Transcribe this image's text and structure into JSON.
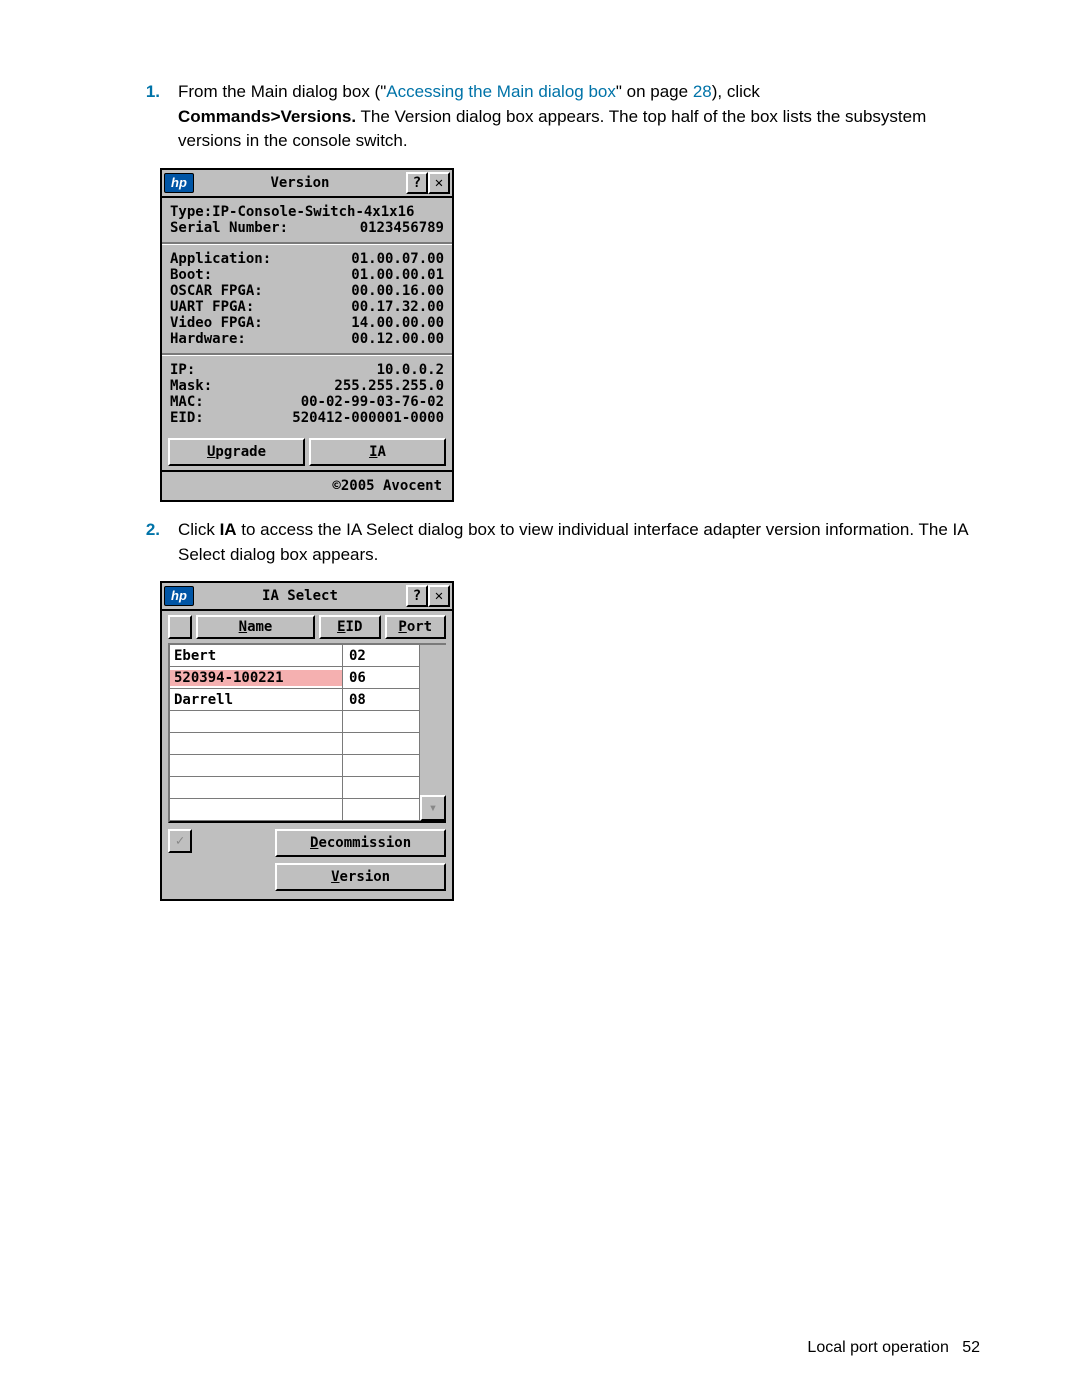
{
  "step1": {
    "num": "1.",
    "pre_text": "From the Main dialog box (\"",
    "link": "Accessing the Main dialog box",
    "post_link": "\" on page ",
    "page_ref": "28",
    "after_ref": "), click",
    "bold": "Commands>Versions.",
    "rest": " The Version dialog box appears. The top half of the box lists the subsystem versions in the console switch."
  },
  "version_dialog": {
    "title": "Version",
    "help": "?",
    "close": "✕",
    "logo": "hp",
    "type_label": "Type:",
    "type_value": "IP-Console-Switch-4x1x16",
    "serial_label": "Serial Number:",
    "serial_value": "0123456789",
    "rows": [
      {
        "k": "Application:",
        "v": "01.00.07.00"
      },
      {
        "k": "Boot:",
        "v": "01.00.00.01"
      },
      {
        "k": "OSCAR FPGA:",
        "v": "00.00.16.00"
      },
      {
        "k": "UART FPGA:",
        "v": "00.17.32.00"
      },
      {
        "k": "Video FPGA:",
        "v": "14.00.00.00"
      },
      {
        "k": "Hardware:",
        "v": "00.12.00.00"
      }
    ],
    "net": [
      {
        "k": "IP:",
        "v": "10.0.0.2"
      },
      {
        "k": "Mask:",
        "v": "255.255.255.0"
      },
      {
        "k": "MAC:",
        "v": "00-02-99-03-76-02"
      },
      {
        "k": "EID:",
        "v": "520412-000001-0000"
      }
    ],
    "upgrade_u": "U",
    "upgrade_rest": "pgrade",
    "ia_u": "I",
    "ia_rest": "A",
    "copyright": "©2005 Avocent"
  },
  "step2": {
    "num": "2.",
    "pre": "Click ",
    "bold": "IA",
    "rest": " to access the IA Select dialog box to view individual interface adapter version information. The IA Select dialog box appears."
  },
  "ia_dialog": {
    "title": "IA Select",
    "help": "?",
    "close": "✕",
    "logo": "hp",
    "hdr_name_u": "N",
    "hdr_name_rest": "ame",
    "hdr_eid_u": "E",
    "hdr_eid_rest": "ID",
    "hdr_port_u": "P",
    "hdr_port_rest": "ort",
    "rows": [
      {
        "name": "Ebert",
        "port": "02",
        "hl": false
      },
      {
        "name": "520394-100221",
        "port": "06",
        "hl": true
      },
      {
        "name": "Darrell",
        "port": "08",
        "hl": false
      },
      {
        "name": "",
        "port": "",
        "hl": false
      },
      {
        "name": "",
        "port": "",
        "hl": false
      },
      {
        "name": "",
        "port": "",
        "hl": false
      },
      {
        "name": "",
        "port": "",
        "hl": false
      },
      {
        "name": "",
        "port": "",
        "hl": false
      }
    ],
    "check": "✓",
    "down": "▾",
    "decom_u": "D",
    "decom_rest": "ecommission",
    "ver_u": "V",
    "ver_rest": "ersion"
  },
  "footer": {
    "text": "Local port operation",
    "page": "52"
  }
}
